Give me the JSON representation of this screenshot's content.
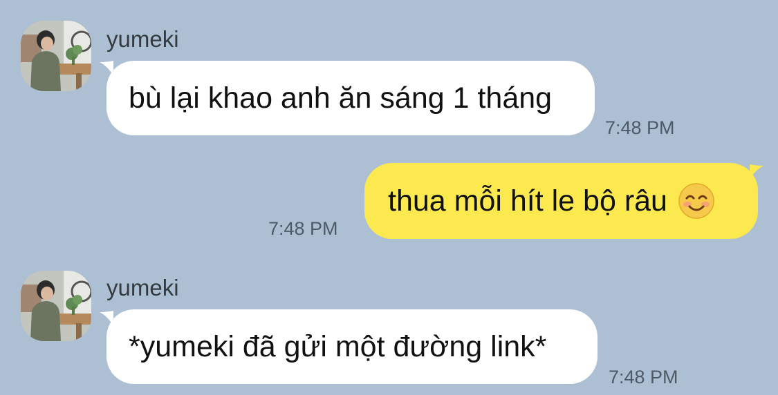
{
  "messages": [
    {
      "direction": "incoming",
      "sender": "yumeki",
      "text": "bù lại khao anh ăn sáng 1 tháng",
      "time": "7:48 PM"
    },
    {
      "direction": "outgoing",
      "text": "thua mỗi hít le bộ râu",
      "emoji": "smiling-face-icon",
      "time": "7:48 PM"
    },
    {
      "direction": "incoming",
      "sender": "yumeki",
      "text": "*yumeki đã gửi một đường link*",
      "time": "7:48 PM"
    }
  ],
  "colors": {
    "background": "#adc0d3",
    "incoming_bubble": "#ffffff",
    "outgoing_bubble": "#fbe94f",
    "timestamp": "#4d5966"
  }
}
